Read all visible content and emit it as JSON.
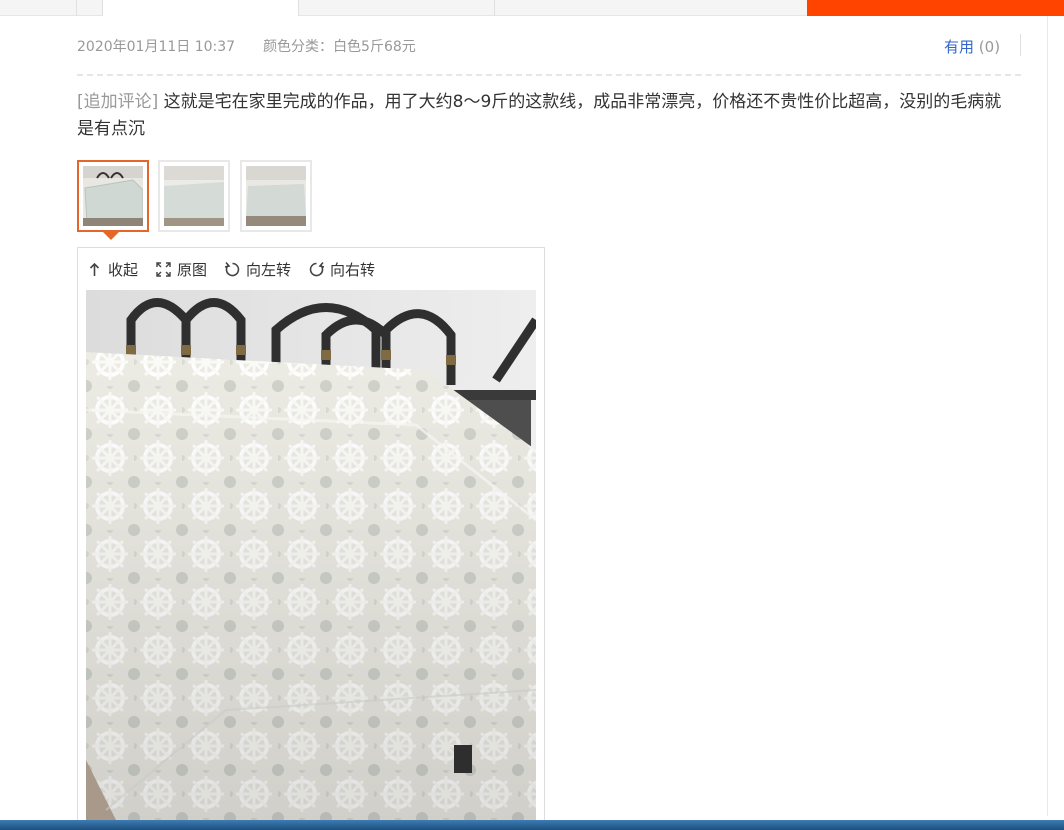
{
  "meta": {
    "date": "2020年01月11日 10:37",
    "sku_label": "颜色分类：",
    "sku_value": "白色5斤68元"
  },
  "useful": {
    "label": "有用",
    "count": "(0)"
  },
  "comment": {
    "tag": "[追加评论]",
    "text": " 这就是宅在家里完成的作品，用了大约8～9斤的这款线，成品非常漂亮，价格还不贵性价比超高，没别的毛病就是有点沉"
  },
  "viewer": {
    "toolbar": [
      {
        "label": "收起",
        "icon": "collapse-icon"
      },
      {
        "label": "原图",
        "icon": "fullscreen-icon"
      },
      {
        "label": "向左转",
        "icon": "rotate-left-icon"
      },
      {
        "label": "向右转",
        "icon": "rotate-right-icon"
      }
    ],
    "active_thumb": 0
  },
  "colors": {
    "accent": "#ff4400",
    "thumb_active": "#e4662a",
    "link": "#3366cc",
    "muted": "#999999"
  }
}
